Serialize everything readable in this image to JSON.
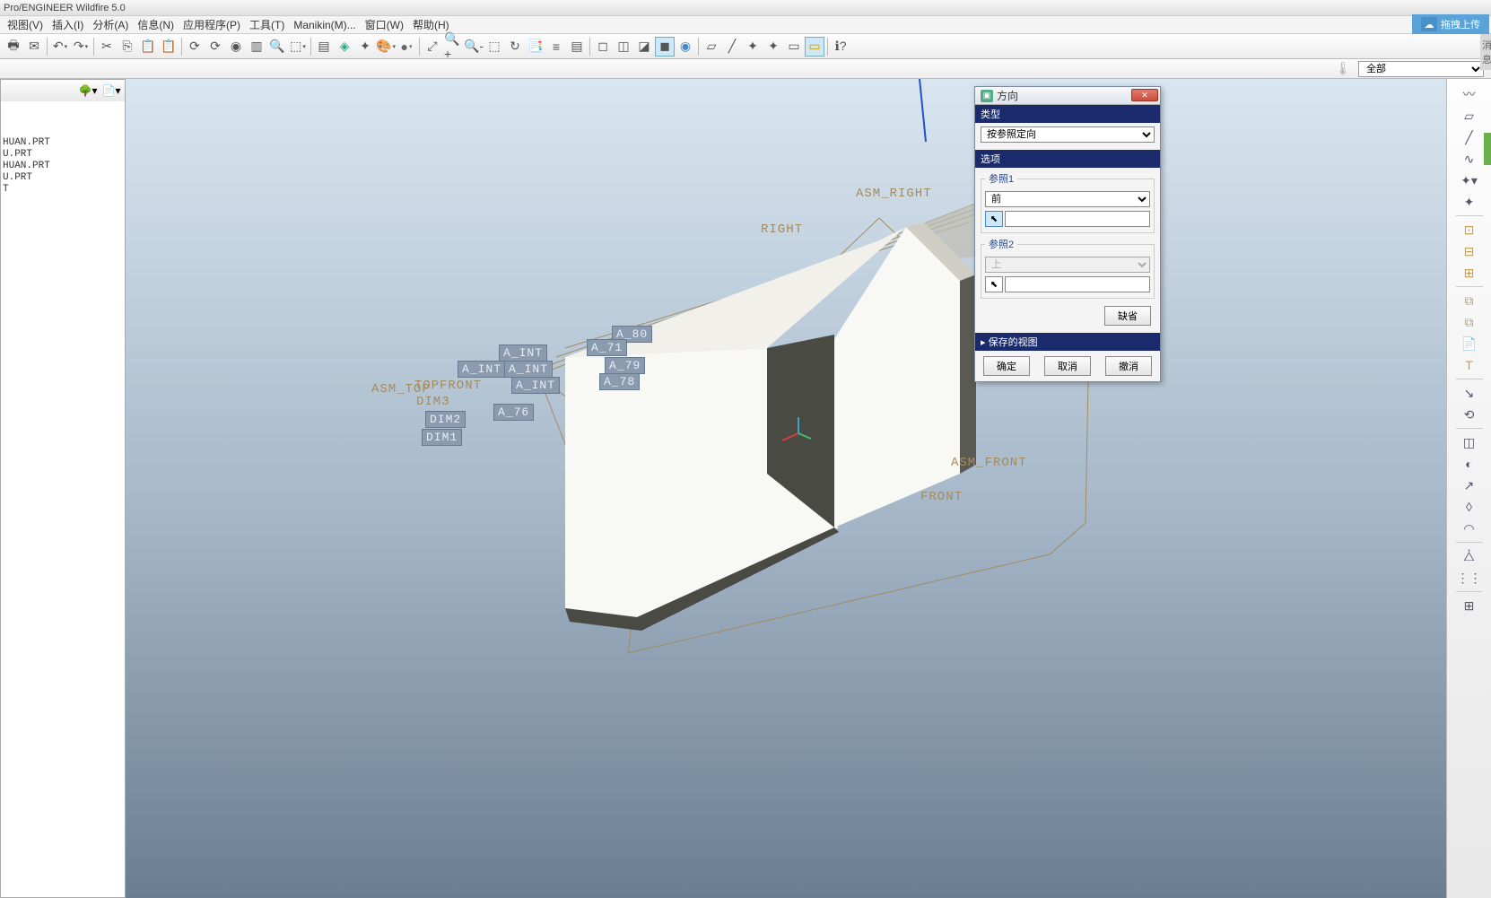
{
  "title": "Pro/ENGINEER Wildfire 5.0",
  "upload": "拖拽上传",
  "msg_tab": "消息",
  "menu": {
    "view": "视图(V)",
    "insert": "插入(I)",
    "analysis": "分析(A)",
    "info": "信息(N)",
    "app": "应用程序(P)",
    "tools": "工具(T)",
    "manikin": "Manikin(M)...",
    "window": "窗口(W)",
    "help": "帮助(H)"
  },
  "filter": {
    "all": "全部"
  },
  "tree": {
    "items": [
      "HUAN.PRT",
      "U.PRT",
      "HUAN.PRT",
      "U.PRT",
      "T"
    ]
  },
  "labels": {
    "asm_right": "ASM_RIGHT",
    "right": "RIGHT",
    "asm_front": "ASM_FRONT",
    "front": "FRONT",
    "asm_top": "ASM_TOP",
    "top": "TOP",
    "aint1": "A_INT",
    "aint2": "A_INT",
    "aint3": "A_INT",
    "aint4": "A_INT",
    "a80": "A_80",
    "a79": "A_79",
    "a78": "A_78",
    "a71": "A_71",
    "a76": "A_76",
    "dim2": "DIM2",
    "dim1": "DIM1",
    "dim3": "DIM3",
    "front2": "FRONT"
  },
  "dialog": {
    "title": "方向",
    "type_hdr": "类型",
    "type_value": "按参照定向",
    "options_hdr": "选项",
    "ref1": "参照1",
    "ref1_value": "前",
    "ref2": "参照2",
    "ref2_value": "上",
    "default_btn": "缺省",
    "saved_views": "保存的视图",
    "ok": "确定",
    "cancel": "取消",
    "undo": "撤消"
  }
}
